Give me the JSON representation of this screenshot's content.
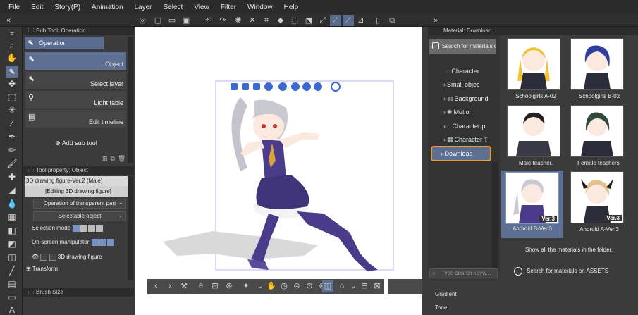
{
  "menu": [
    "File",
    "Edit",
    "Story(P)",
    "Animation",
    "Layer",
    "Select",
    "View",
    "Filter",
    "Window",
    "Help"
  ],
  "subtool": {
    "title": "Sub Tool: Operation",
    "tab": "Operation",
    "items": [
      {
        "label": "Object",
        "selected": true
      },
      {
        "label": "Select layer",
        "selected": false
      },
      {
        "label": "Light table",
        "selected": false
      },
      {
        "label": "Edit timeline",
        "selected": false
      }
    ],
    "add_label": "Add sub tool"
  },
  "toolprop": {
    "title": "Tool property: Object",
    "object_name": "3D drawing figure-Ver.2 (Male)",
    "editing_label": "[Editing 3D drawing figure]",
    "dropdown1": "Operation of transparent part",
    "dropdown2": "Selectable object",
    "selection_mode_label": "Selection mode",
    "manipulator_label": "On-screen manipulator",
    "layer_row_label": "3D drawing figure",
    "transform_label": "Transform"
  },
  "brush": {
    "title": "Brush Size"
  },
  "material": {
    "title": "Material: Download",
    "search_placeholder": "Search for materials on",
    "tree": [
      "Character",
      "Small objec",
      "Background",
      "Motion",
      "Character p",
      "Character T"
    ],
    "download_label": "Download",
    "items": [
      {
        "caption": "Schoolgirls A-02",
        "version": "",
        "selected": false
      },
      {
        "caption": "Schoolgirls B-02",
        "version": "",
        "selected": false
      },
      {
        "caption": "Male teacher.",
        "version": "",
        "selected": false
      },
      {
        "caption": "Female teachers.",
        "version": "",
        "selected": false
      },
      {
        "caption": "Android B-Ver.3",
        "version": "Ver.3",
        "selected": true
      },
      {
        "caption": "Android A-Ver.3",
        "version": "Ver.3",
        "selected": false
      }
    ],
    "show_all": "Show all the materials in the folder.",
    "assets_link": "Search for materials on ASSETS",
    "keyword_placeholder": "Type search keyw...",
    "list": [
      "Gradient",
      "Tone"
    ]
  },
  "colors": {
    "accent": "#5d6f93",
    "highlight": "#f29a2e",
    "panel": "#3b3b3b"
  }
}
